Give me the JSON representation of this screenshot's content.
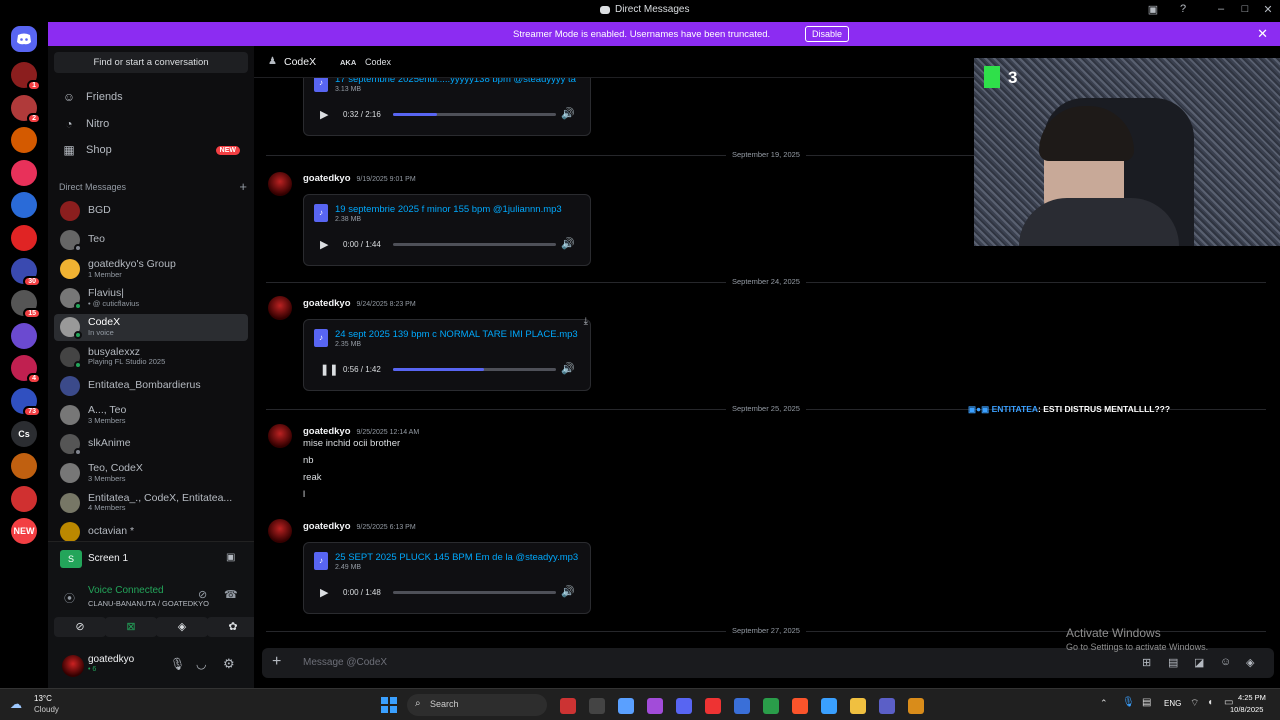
{
  "window": {
    "title": "Direct Messages"
  },
  "banner": {
    "text": "Streamer Mode is enabled. Usernames have been truncated.",
    "button": "Disable"
  },
  "servers": [
    {
      "badge": "1",
      "color": "#8b1e1e"
    },
    {
      "badge": "2",
      "color": "#b03a3a"
    },
    {
      "badge": "",
      "color": "#d45a00"
    },
    {
      "badge": "",
      "color": "#e8315a"
    },
    {
      "badge": "",
      "color": "#2a6bd8"
    },
    {
      "badge": "",
      "color": "#e02424"
    },
    {
      "badge": "30",
      "color": "#3a4ab0"
    },
    {
      "badge": "15",
      "color": "#555"
    },
    {
      "badge": "",
      "color": "#6b4ad0"
    },
    {
      "badge": "4",
      "color": "#c02050"
    },
    {
      "badge": "73",
      "color": "#3050c0"
    },
    {
      "badge": "",
      "color": "#2b2d31",
      "label": "Cs"
    },
    {
      "badge": "",
      "color": "#c06010"
    },
    {
      "badge": "",
      "color": "#d03030"
    },
    {
      "badge": "",
      "color": "#f23f43",
      "label": "NEW"
    }
  ],
  "dm_panel": {
    "search_placeholder": "Find or start a conversation",
    "nav": [
      {
        "label": "Friends",
        "icon": "friends-icon"
      },
      {
        "label": "Nitro",
        "icon": "nitro-icon"
      },
      {
        "label": "Shop",
        "icon": "shop-icon",
        "tag": "NEW"
      }
    ],
    "section": "Direct Messages",
    "dms": [
      {
        "name": "BGD",
        "sub": "",
        "status": "",
        "color": "#8b1e1e"
      },
      {
        "name": "Teo",
        "sub": "",
        "status": "#80848e",
        "color": "#666"
      },
      {
        "name": "goatedkyo's Group",
        "sub": "1 Member",
        "status": "",
        "color": "#f0b232"
      },
      {
        "name": "Flavius|",
        "sub": "• @ cuticflavius",
        "status": "#23a55a",
        "color": "#777"
      },
      {
        "name": "CodeX",
        "sub": "In voice",
        "status": "#23a55a",
        "color": "#999",
        "selected": true
      },
      {
        "name": "busyalexxz",
        "sub": "Playing FL Studio 2025",
        "status": "#23a55a",
        "color": "#444"
      },
      {
        "name": "Entitatea_Bombardierus",
        "sub": "",
        "status": "",
        "color": "#3b4a8a"
      },
      {
        "name": "A..., Teo",
        "sub": "3 Members",
        "status": "",
        "color": "#777"
      },
      {
        "name": "slkAnime",
        "sub": "",
        "status": "#80848e",
        "color": "#555"
      },
      {
        "name": "Teo, CodeX",
        "sub": "3 Members",
        "status": "",
        "color": "#777"
      },
      {
        "name": "Entitatea_., CodeX, Entitatea...",
        "sub": "4 Members",
        "status": "",
        "color": "#776"
      },
      {
        "name": "octavian *",
        "sub": "",
        "status": "",
        "color": "#bb8800"
      }
    ]
  },
  "screen_share": {
    "label": "Screen 1"
  },
  "voice": {
    "status": "Voice Connected",
    "channel": "CLANU-BANANUTA / GOATEDKYO"
  },
  "user": {
    "name": "goatedkyo",
    "sub": "• 6"
  },
  "header": {
    "name": "CodeX",
    "aka_label": "AKA",
    "aka": "Codex"
  },
  "messages": [
    {
      "top_attachment": {
        "file": "17 septembrie 2025endl.....yyyyy138 bpm @steadyyyy ta",
        "size": "3.13 MB",
        "time": "0:32 / 2:16",
        "progress": 0.27
      }
    },
    {
      "date": "September 19, 2025",
      "author": "goatedkyo",
      "timestamp": "9/19/2025 9:01 PM",
      "attachment": {
        "file": "19 septembrie 2025 f minor 155 bpm @1juliannn.mp3",
        "size": "2.38 MB",
        "time": "0:00 / 1:44",
        "progress": 0.0
      }
    },
    {
      "date": "September 24, 2025",
      "author": "goatedkyo",
      "timestamp": "9/24/2025 8:23 PM",
      "attachment": {
        "file": "24 sept 2025 139 bpm c NORMAL TARE IMI PLACE.mp3",
        "size": "2.35 MB",
        "time": "0:56 / 1:42",
        "progress": 0.56,
        "playing": true
      }
    },
    {
      "date": "September 25, 2025",
      "author": "goatedkyo",
      "timestamp": "9/25/2025 12:14 AM",
      "lines": [
        "mise inchid ocii brother",
        "nb",
        "reak",
        "l"
      ]
    },
    {
      "author": "goatedkyo",
      "timestamp": "9/25/2025 6:13 PM",
      "attachment": {
        "file": "25 SEPT 2025 PLUCK 145 BPM Em de la @steadyy.mp3",
        "size": "2.49 MB",
        "time": "0:00 / 1:48",
        "progress": 0.0
      }
    },
    {
      "date": "September 27, 2025"
    }
  ],
  "stream_overlay": {
    "counter": "3",
    "chat_user": "ENTITATEA",
    "chat_text": ": ESTI DISTRUS MENTALLLL???"
  },
  "composer": {
    "placeholder": "Message @CodeX"
  },
  "watermark": {
    "line1": "Activate Windows",
    "line2": "Go to Settings to activate Windows."
  },
  "taskbar": {
    "weather_temp": "13°C",
    "weather_desc": "Cloudy",
    "search": "Search",
    "lang": "ENG",
    "time": "4:25 PM",
    "date": "10/8/2025"
  }
}
